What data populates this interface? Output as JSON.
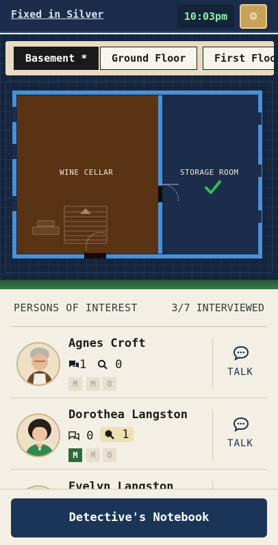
{
  "header": {
    "title": "Fixed in Silver",
    "clock": "10:03pm",
    "settings_icon": "gear-icon"
  },
  "floors": {
    "tabs": [
      {
        "label": "Basement *",
        "active": true
      },
      {
        "label": "Ground Floor",
        "active": false
      },
      {
        "label": "First Floo",
        "active": false
      }
    ]
  },
  "map": {
    "rooms": [
      {
        "label": "WINE CELLAR",
        "color": "#5a3315",
        "checked": false
      },
      {
        "label": "STORAGE ROOM",
        "color": "#1b2d4a",
        "checked": true
      }
    ],
    "wall_color": "#4a90d9",
    "check_color": "#2fbf55"
  },
  "persons": {
    "title": "PERSONS OF INTEREST",
    "count": "3/7 INTERVIEWED",
    "items": [
      {
        "name": "Agnes Croft",
        "messages": "1",
        "questions": "0",
        "questions_highlight": false,
        "badges": [
          "M",
          "M",
          "O"
        ],
        "badges_on": [
          false,
          false,
          false
        ],
        "talk_label": "TALK"
      },
      {
        "name": "Dorothea Langston",
        "messages": "0",
        "questions": "1",
        "questions_highlight": true,
        "badges": [
          "M",
          "M",
          "O"
        ],
        "badges_on": [
          true,
          false,
          false
        ],
        "talk_label": "TALK"
      },
      {
        "name": "Evelyn Langston"
      }
    ]
  },
  "footer": {
    "notebook_label": "Detective's Notebook"
  }
}
